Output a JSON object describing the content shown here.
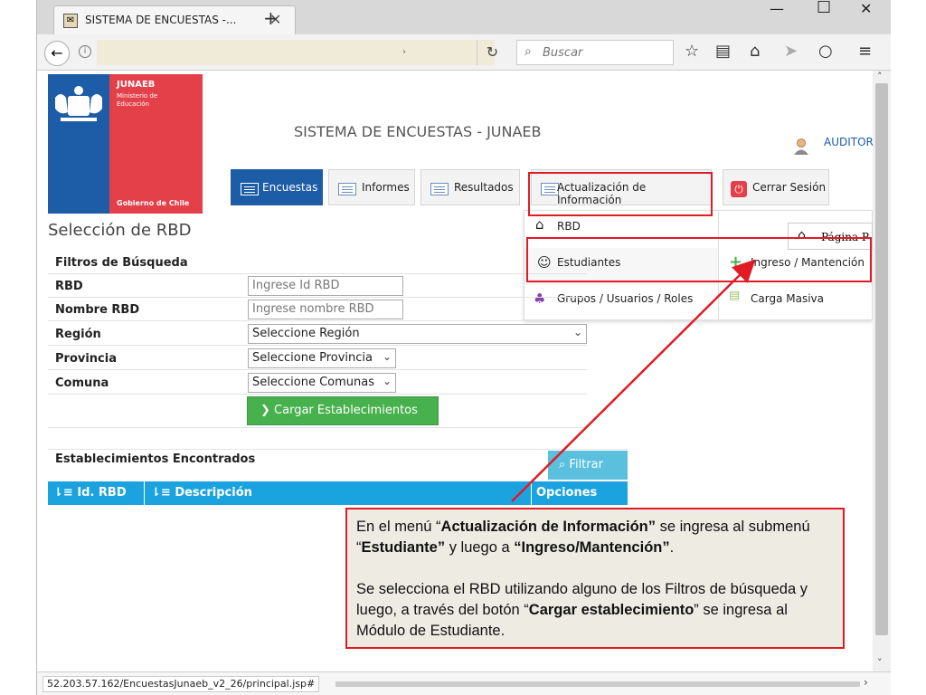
{
  "browser": {
    "tab_title": "SISTEMA DE ENCUESTAS -...",
    "search_placeholder": "Buscar",
    "status_url": "52.203.57.162/EncuestasJunaeb_v2_26/principal.jsp#"
  },
  "logo": {
    "org": "JUNAEB",
    "ministry": "Ministerio de Educación",
    "government": "Gobierno de Chile"
  },
  "header": {
    "site_title": "SISTEMA DE ENCUESTAS - JUNAEB",
    "user": "AUDITOR"
  },
  "menu": {
    "encuestas": "Encuestas",
    "informes": "Informes",
    "resultados": "Resultados",
    "actualizacion": "Actualización de Información",
    "cerrar": "Cerrar Sesión"
  },
  "dropdown": {
    "rbd": "RBD",
    "estudiantes": "Estudiantes",
    "ingreso": "Ingreso / Mantención",
    "grupos": "Grupos / Usuarios / Roles",
    "carga": "Carga Masiva",
    "pagina": "Página P"
  },
  "form": {
    "title": "Selección de RBD",
    "filters_header": "Filtros de Búsqueda",
    "rbd_label": "RBD",
    "rbd_placeholder": "Ingrese Id RBD",
    "nombre_label": "Nombre RBD",
    "nombre_placeholder": "Ingrese nombre RBD",
    "region_label": "Región",
    "region_value": "Seleccione Región",
    "provincia_label": "Provincia",
    "provincia_value": "Seleccione Provincia",
    "comuna_label": "Comuna",
    "comuna_value": "Seleccione Comunas",
    "load_button": "Cargar Establecimientos"
  },
  "results": {
    "title": "Establecimientos Encontrados",
    "filter_button": "Filtrar",
    "col_id": "Id. RBD",
    "col_desc": "Descripción",
    "col_options": "Opciones"
  },
  "callout": {
    "p1_a": "En el menú  “",
    "p1_b": "Actualización de Información”",
    "p1_c": " se ingresa al submenú  “",
    "p1_d": "Estudiante”",
    "p1_e": " y luego a ",
    "p1_f": "“Ingreso/Mantención”",
    "p1_g": ".",
    "p2_a": "Se selecciona el RBD utilizando alguno de los Filtros de búsqueda y luego, a través del botón “",
    "p2_b": "Cargar establecimiento",
    "p2_c": "” se ingresa al Módulo de Estudiante."
  },
  "colors": {
    "accent_blue": "#1d5ca6",
    "annotation_red": "#e01b24",
    "success_green": "#47b14d",
    "table_header": "#1ba3e0"
  }
}
